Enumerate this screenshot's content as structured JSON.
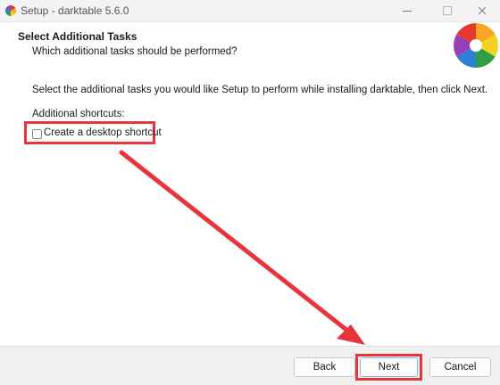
{
  "window": {
    "title": "Setup - darktable 5.6.0",
    "controls": [
      "minimize",
      "maximize",
      "close"
    ]
  },
  "header": {
    "title": "Select Additional Tasks",
    "subtitle": "Which additional tasks should be performed?"
  },
  "body": {
    "instructions": "Select the additional tasks you would like Setup to perform while installing darktable, then click Next.",
    "group_label": "Additional shortcuts:",
    "checkbox": {
      "label": "Create a desktop shortcut",
      "checked": false
    }
  },
  "buttons": {
    "back": "Back",
    "next": "Next",
    "cancel": "Cancel"
  },
  "colors": {
    "highlight": "#e8353c",
    "titlebar": "#f3f3f3",
    "footer": "#f0f0f0"
  },
  "icons": [
    "darktable-logo-icon",
    "minimize-icon",
    "maximize-icon",
    "close-icon",
    "annotation-arrow"
  ]
}
